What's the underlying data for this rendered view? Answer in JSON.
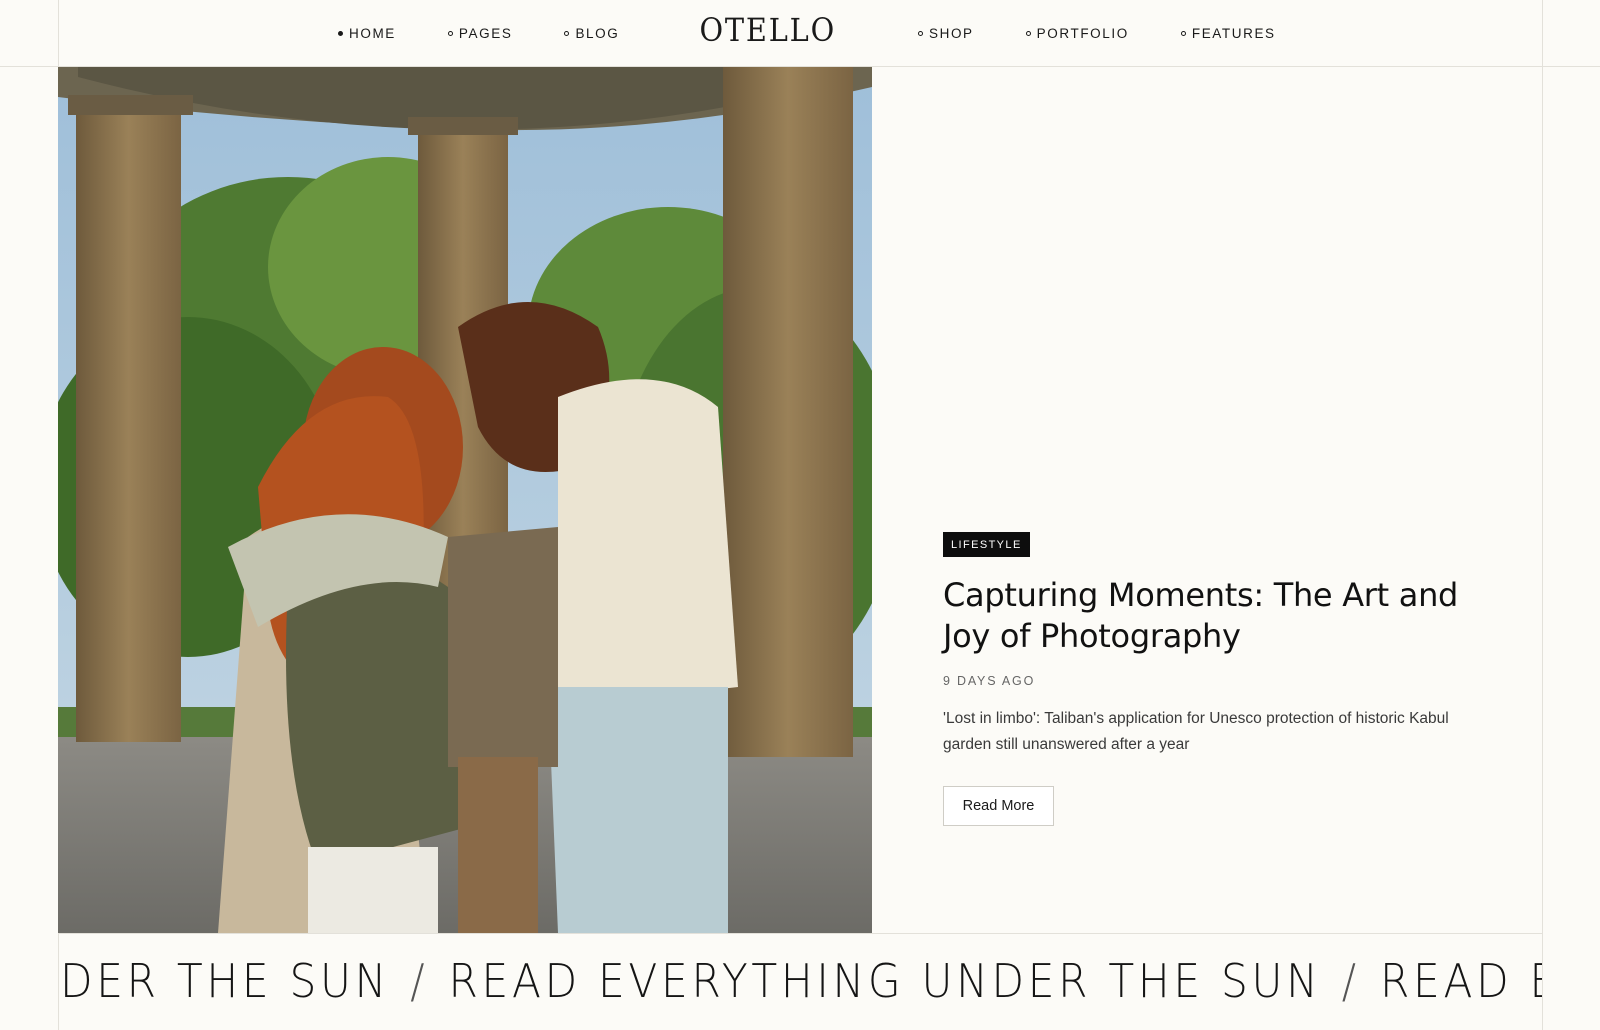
{
  "nav": {
    "left": [
      {
        "label": "HOME",
        "active": true
      },
      {
        "label": "PAGES",
        "active": false
      },
      {
        "label": "BLOG",
        "active": false
      }
    ],
    "right": [
      {
        "label": "SHOP",
        "active": false
      },
      {
        "label": "PORTFOLIO",
        "active": false
      },
      {
        "label": "FEATURES",
        "active": false
      }
    ],
    "logo": "OTELLO"
  },
  "hero": {
    "image_icon": "photo-of-friends-embracing-under-rotunda",
    "category": "LIFESTYLE",
    "title": "Capturing Moments: The Art and Joy of Photography",
    "meta": "9 DAYS AGO",
    "excerpt": "'Lost in limbo': Taliban's application for Unesco protection of historic Kabul garden still unanswered after a year",
    "read_more": "Read More"
  },
  "ticker": {
    "segments": [
      "UNDER THE SUN",
      "READ EVERYTHING UNDER THE SUN",
      "READ EVERYTHING"
    ],
    "separator": "/"
  },
  "colors": {
    "background": "#fcfbf7",
    "text": "#141414",
    "badge": "#0d0d0d",
    "border": "#e3e1da"
  }
}
